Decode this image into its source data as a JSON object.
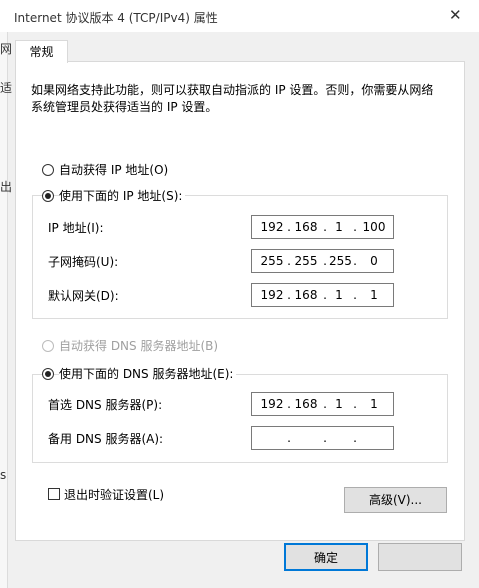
{
  "window": {
    "title": "Internet 协议版本 4 (TCP/IPv4) 属性",
    "close_glyph": "✕"
  },
  "tabs": [
    {
      "label": "常规"
    }
  ],
  "description": "如果网络支持此功能，则可以获取自动指派的 IP 设置。否则，你需要从网络系统管理员处获得适当的 IP 设置。",
  "ip_mode": {
    "auto_label": "自动获得 IP 地址(O)",
    "manual_label": "使用下面的 IP 地址(S):",
    "selected": "manual"
  },
  "ip_fields": [
    {
      "label": "IP 地址(I):",
      "octets": [
        "192",
        "168",
        "1",
        "100"
      ]
    },
    {
      "label": "子网掩码(U):",
      "octets": [
        "255",
        "255",
        "255",
        "0"
      ]
    },
    {
      "label": "默认网关(D):",
      "octets": [
        "192",
        "168",
        "1",
        "1"
      ]
    }
  ],
  "dns_mode": {
    "auto_label": "自动获得 DNS 服务器地址(B)",
    "manual_label": "使用下面的 DNS 服务器地址(E):",
    "selected": "manual"
  },
  "dns_fields": [
    {
      "label": "首选 DNS 服务器(P):",
      "octets": [
        "192",
        "168",
        "1",
        "1"
      ]
    },
    {
      "label": "备用 DNS 服务器(A):",
      "octets": [
        "",
        "",
        "",
        ""
      ]
    }
  ],
  "validate": {
    "label": "退出时验证设置(L)",
    "checked": false
  },
  "buttons": {
    "advanced": "高级(V)...",
    "ok": "确定"
  },
  "background_fragments": [
    "网",
    "适",
    "出",
    "s"
  ]
}
